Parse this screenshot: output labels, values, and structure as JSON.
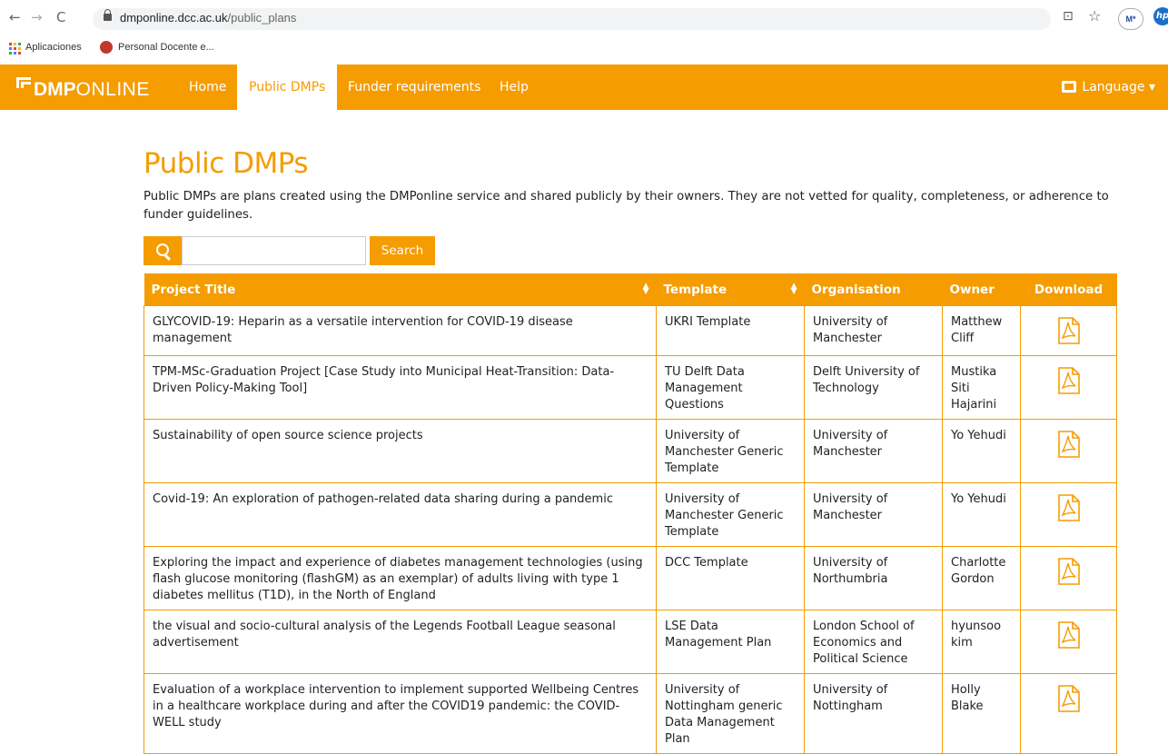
{
  "browser": {
    "url_host": "dmponline.dcc.ac.uk",
    "url_path": "/public_plans",
    "back_glyph": "←",
    "forward_glyph": "→",
    "reload_glyph": "C",
    "star_glyph": "☆",
    "translate_glyph": "⊡",
    "profile_label": "M*",
    "hp_label": "hp",
    "bookmarks": [
      "Aplicaciones",
      "Personal Docente e..."
    ]
  },
  "brand": {
    "logo_dmp": "DMP",
    "logo_online": "ONLINE",
    "accent": "#f59c00"
  },
  "nav": {
    "items": [
      {
        "label": "Home",
        "active": false
      },
      {
        "label": "Public DMPs",
        "active": true
      },
      {
        "label": "Funder requirements",
        "active": false
      },
      {
        "label": "Help",
        "active": false
      }
    ],
    "language": "Language ▾"
  },
  "page": {
    "title": "Public DMPs",
    "intro": "Public DMPs are plans created using the DMPonline service and shared publicly by their owners. They are not vetted for quality, completeness, or adherence to funder guidelines."
  },
  "search": {
    "value": "",
    "button": "Search"
  },
  "table": {
    "headers": [
      "Project Title",
      "Template",
      "Organisation",
      "Owner",
      "Download"
    ],
    "rows": [
      {
        "title": "GLYCOVID-19: Heparin as a versatile intervention for COVID-19 disease management",
        "template": "UKRI Template",
        "org": "University of Manchester",
        "owner": "Matthew Cliff"
      },
      {
        "title": "TPM-MSc-Graduation Project [Case Study into Municipal Heat-Transition: Data-Driven Policy-Making Tool]",
        "template": "TU Delft Data Management Questions",
        "org": "Delft University of Technology",
        "owner": "Mustika Siti Hajarini"
      },
      {
        "title": "Sustainability of open source science projects",
        "template": "University of Manchester Generic Template",
        "org": "University of Manchester",
        "owner": "Yo Yehudi"
      },
      {
        "title": "Covid-19: An exploration of pathogen-related data sharing during a pandemic",
        "template": "University of Manchester Generic Template",
        "org": "University of Manchester",
        "owner": "Yo Yehudi"
      },
      {
        "title": "Exploring the impact and experience of diabetes management technologies (using flash glucose monitoring (flashGM) as an exemplar) of adults living with type 1 diabetes mellitus (T1D), in the North of England",
        "template": "DCC Template",
        "org": "University of Northumbria",
        "owner": "Charlotte Gordon"
      },
      {
        "title": "the visual and socio-cultural analysis of the Legends Football League seasonal advertisement",
        "template": "LSE Data Management Plan",
        "org": "London School of Economics and Political Science",
        "owner": "hyunsoo kim"
      },
      {
        "title": "Evaluation of a workplace intervention to implement supported Wellbeing Centres in a healthcare workplace during and after the COVID19 pandemic: the COVID-WELL study",
        "template": "University of Nottingham generic Data Management Plan",
        "org": "University of Nottingham",
        "owner": "Holly Blake"
      }
    ]
  }
}
